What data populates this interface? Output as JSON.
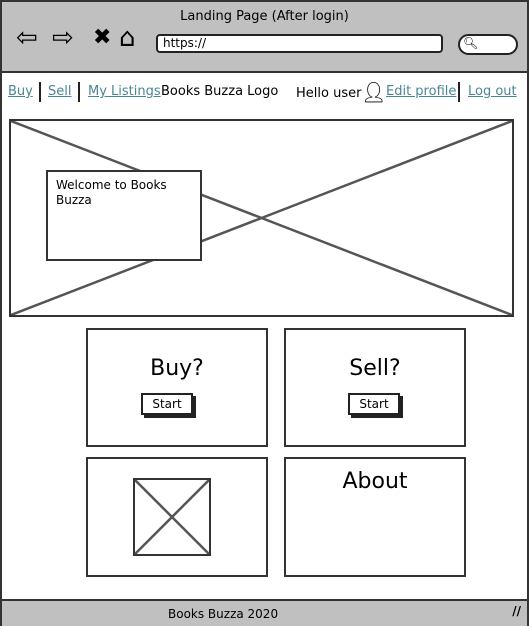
{
  "window": {
    "title": "Landing Page (After login)",
    "url": "https://"
  },
  "nav": {
    "buy": "Buy",
    "sell": "Sell",
    "my_listings": "My Listings",
    "logo": "Books Buzza Logo",
    "greeting": "Hello user",
    "edit_profile": "Edit profile",
    "logout": "Log out"
  },
  "hero": {
    "welcome": "Welcome to Books Buzza"
  },
  "cards": {
    "buy_title": "Buy?",
    "buy_button": "Start",
    "sell_title": "Sell?",
    "sell_button": "Start",
    "about_title": "About"
  },
  "footer": {
    "text": "Books Buzza 2020"
  },
  "colors": {
    "link": "#4a8595",
    "chrome": "#c0c0c0"
  }
}
